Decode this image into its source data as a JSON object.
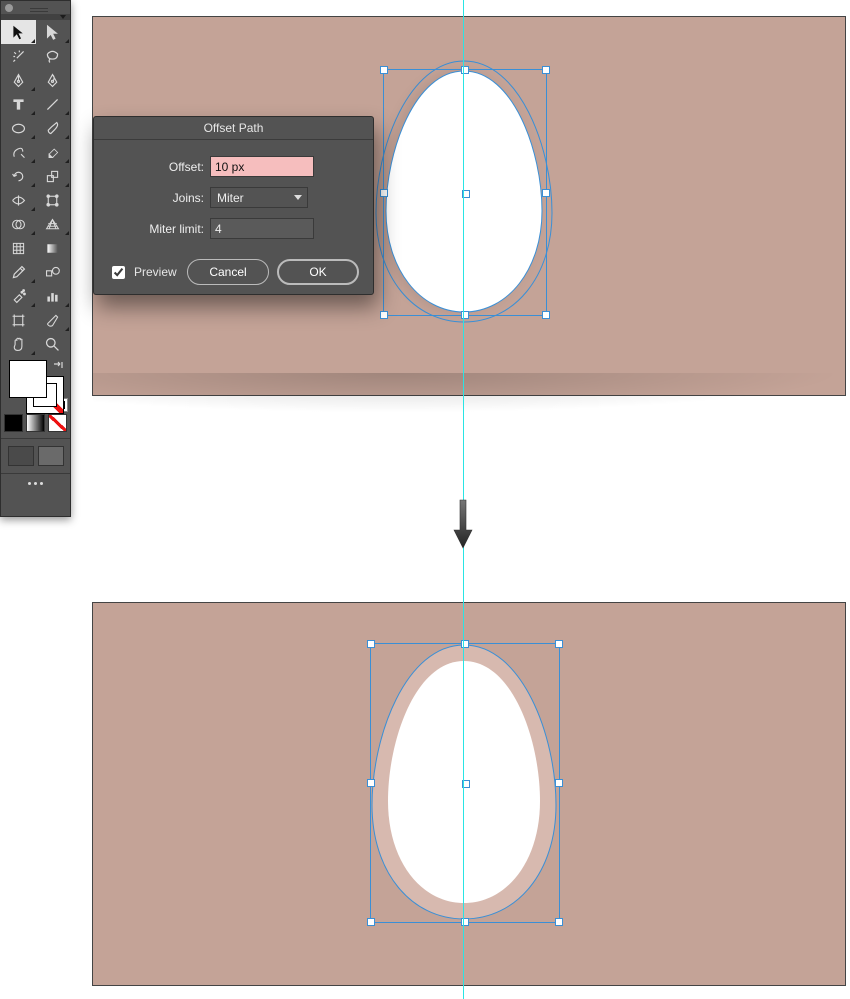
{
  "dialog": {
    "title": "Offset Path",
    "offset_label": "Offset:",
    "offset_value": "10 px",
    "joins_label": "Joins:",
    "joins_value": "Miter",
    "miter_label": "Miter limit:",
    "miter_value": "4",
    "preview_label": "Preview",
    "preview_checked": true,
    "cancel_label": "Cancel",
    "ok_label": "OK"
  },
  "tools": [
    "selection-tool",
    "direct-selection-tool",
    "magic-wand-tool",
    "lasso-tool",
    "pen-tool",
    "curvature-tool",
    "type-tool",
    "line-segment-tool",
    "rectangle-tool",
    "paintbrush-tool",
    "shaper-tool",
    "eraser-tool",
    "rotate-tool",
    "scale-tool",
    "width-tool",
    "free-transform-tool",
    "shape-builder-tool",
    "perspective-grid-tool",
    "mesh-tool",
    "gradient-tool",
    "eyedropper-tool",
    "blend-tool",
    "symbol-sprayer-tool",
    "column-graph-tool",
    "artboard-tool",
    "slice-tool",
    "hand-tool",
    "zoom-tool"
  ],
  "colors": {
    "canvas_bg": "#c4a397",
    "guide": "#29e4e4",
    "selection": "#3a8fd6",
    "offset_fill": "#d7b9af"
  }
}
